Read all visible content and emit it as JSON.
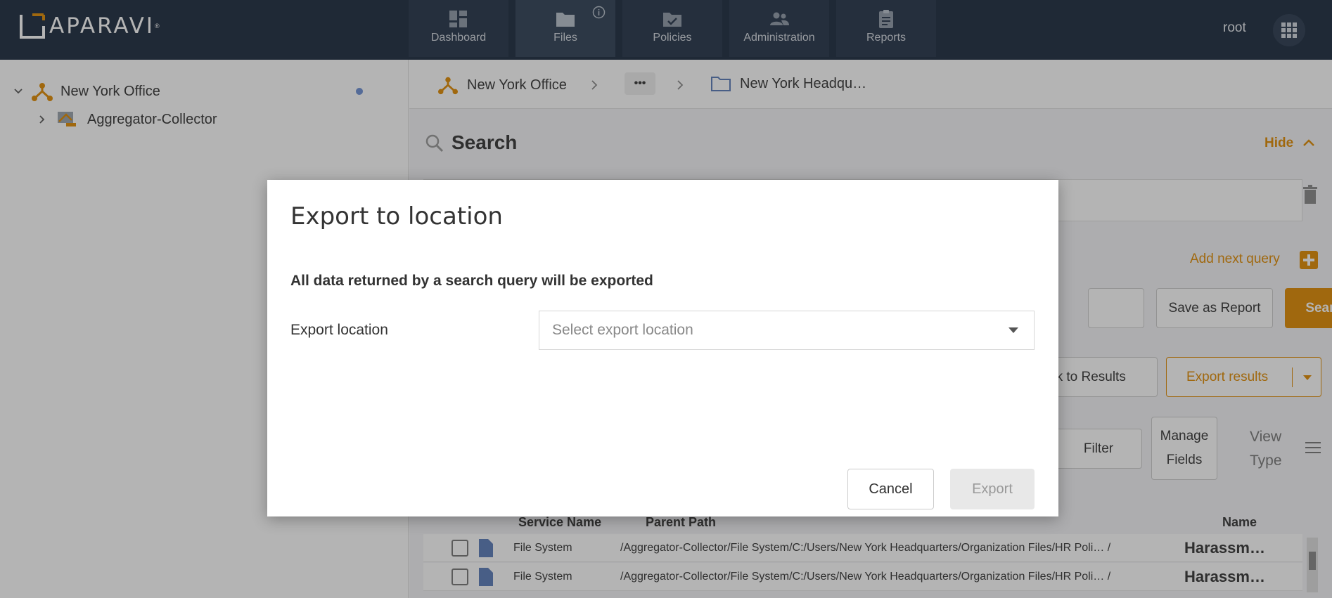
{
  "app": {
    "logo_text": "APARAVI",
    "logo_reg": "®",
    "user": "root"
  },
  "nav": {
    "tabs": [
      {
        "label": "Dashboard",
        "icon": "dashboard-icon"
      },
      {
        "label": "Files",
        "icon": "folder-icon",
        "active": true
      },
      {
        "label": "Policies",
        "icon": "policies-icon"
      },
      {
        "label": "Administration",
        "icon": "people-icon"
      },
      {
        "label": "Reports",
        "icon": "clipboard-icon"
      }
    ]
  },
  "sidebar": {
    "items": [
      {
        "label": "New York Office",
        "icon": "node-icon",
        "expanded": true
      },
      {
        "label": "Aggregator-Collector",
        "icon": "collector-icon",
        "expanded": false
      }
    ]
  },
  "breadcrumb": {
    "items": [
      "New York Office",
      "•••",
      "New York Headqu…"
    ]
  },
  "search_panel": {
    "title": "Search",
    "hide_label": "Hide",
    "add_query_label": "Add next query",
    "save_report_label": "Save as Report",
    "search_label": "Search",
    "link_results_label": "nk to Results",
    "export_results_label": "Export results",
    "filter_label": "Filter",
    "manage_fields_label_1": "Manage",
    "manage_fields_label_2": "Fields",
    "view_type_label_1": "View",
    "view_type_label_2": "Type"
  },
  "table": {
    "columns": [
      "Service Name",
      "Parent Path",
      "Name"
    ],
    "rows": [
      {
        "service": "File System",
        "path": "/Aggregator-Collector/File System/C:/Users/New York Headquarters/Organization Files/HR Poli… /",
        "name": "Harassm…"
      },
      {
        "service": "File System",
        "path": "/Aggregator-Collector/File System/C:/Users/New York Headquarters/Organization Files/HR Poli… /",
        "name": "Harassm…"
      }
    ]
  },
  "dialog": {
    "title": "Export to location",
    "description": "All data returned by a search query will be exported",
    "location_label": "Export location",
    "location_placeholder": "Select export location",
    "cancel_label": "Cancel",
    "export_label": "Export"
  },
  "colors": {
    "topbar": "#1b2a3e",
    "accent": "#e08a00"
  }
}
